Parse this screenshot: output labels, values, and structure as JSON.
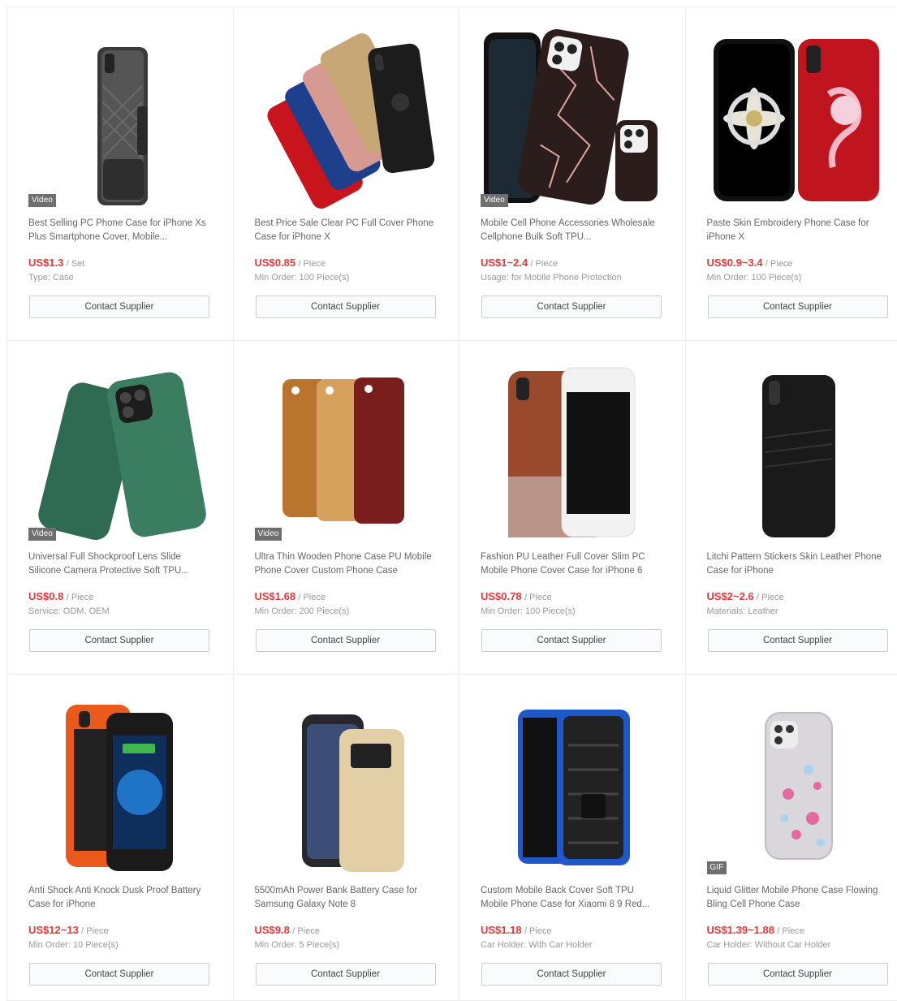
{
  "products": [
    {
      "title": "Best Selling PC Phone Case for iPhone Xs Plus Smartphone Cover, Mobile...",
      "price": "US$1.3",
      "unit": "/ Set",
      "spec": "Type: Case",
      "badge": "Video",
      "button": "Contact Supplier",
      "image_icon": "holster-phone-case-icon"
    },
    {
      "title": "Best Price Sale Clear PC Full Cover Phone Case for iPhone X",
      "price": "US$0.85",
      "unit": "/ Piece",
      "spec": "Min Order: 100 Piece(s)",
      "badge": "",
      "button": "Contact Supplier",
      "image_icon": "colorful-phone-cases-icon"
    },
    {
      "title": "Mobile Cell Phone Accessories Wholesale Cellphone Bulk Soft TPU...",
      "price": "US$1~2.4",
      "unit": "/ Piece",
      "spec": "Usage: for Mobile Phone Protection",
      "badge": "Video",
      "button": "Contact Supplier",
      "image_icon": "marble-phone-case-icon"
    },
    {
      "title": "Paste Skin Embroidery Phone Case for iPhone X",
      "price": "US$0.9~3.4",
      "unit": "/ Piece",
      "spec": "Min Order: 100 Piece(s)",
      "badge": "",
      "button": "Contact Supplier",
      "image_icon": "embroidery-phone-case-icon"
    },
    {
      "title": "Universal Full Shockproof Lens Slide Silicone Camera Protective Soft TPU...",
      "price": "US$0.8",
      "unit": "/ Piece",
      "spec": "Service: ODM, OEM",
      "badge": "Video",
      "button": "Contact Supplier",
      "image_icon": "green-phone-case-icon"
    },
    {
      "title": "Ultra Thin Wooden Phone Case PU Mobile Phone Cover Custom Phone Case",
      "price": "US$1.68",
      "unit": "/ Piece",
      "spec": "Min Order: 200 Piece(s)",
      "badge": "Video",
      "button": "Contact Supplier",
      "image_icon": "wooden-phone-case-icon"
    },
    {
      "title": "Fashion PU Leather Full Cover Slim PC Mobile Phone Cover Case for iPhone 6",
      "price": "US$0.78",
      "unit": "/ Piece",
      "spec": "Min Order: 100 Piece(s)",
      "badge": "",
      "button": "Contact Supplier",
      "image_icon": "leather-phone-case-icon"
    },
    {
      "title": "Litchi Pattern Stickers Skin Leather Phone Case for iPhone",
      "price": "US$2~2.6",
      "unit": "/ Piece",
      "spec": "Materials: Leather",
      "badge": "",
      "button": "Contact Supplier",
      "image_icon": "wallet-phone-case-icon"
    },
    {
      "title": "Anti Shock Anti Knock Dusk Proof Battery Case for iPhone",
      "price": "US$12~13",
      "unit": "/ Piece",
      "spec": "Min Order: 10 Piece(s)",
      "badge": "",
      "button": "Contact Supplier",
      "image_icon": "battery-phone-case-icon"
    },
    {
      "title": "5500mAh Power Bank Battery Case for Samsung Galaxy Note 8",
      "price": "US$9.8",
      "unit": "/ Piece",
      "spec": "Min Order: 5 Piece(s)",
      "badge": "",
      "button": "Contact Supplier",
      "image_icon": "power-bank-case-icon"
    },
    {
      "title": "Custom Mobile Back Cover Soft TPU Mobile Phone Case for Xiaomi 8 9 Red...",
      "price": "US$1.18",
      "unit": "/ Piece",
      "spec": "Car Holder: With Car Holder",
      "badge": "",
      "button": "Contact Supplier",
      "image_icon": "rugged-phone-case-icon"
    },
    {
      "title": "Liquid Glitter Mobile Phone Case Flowing Bling Cell Phone Case",
      "price": "US$1.39~1.88",
      "unit": "/ Piece",
      "spec": "Car Holder: Without Car Holder",
      "badge": "GIF",
      "button": "Contact Supplier",
      "image_icon": "glitter-phone-case-icon"
    }
  ]
}
